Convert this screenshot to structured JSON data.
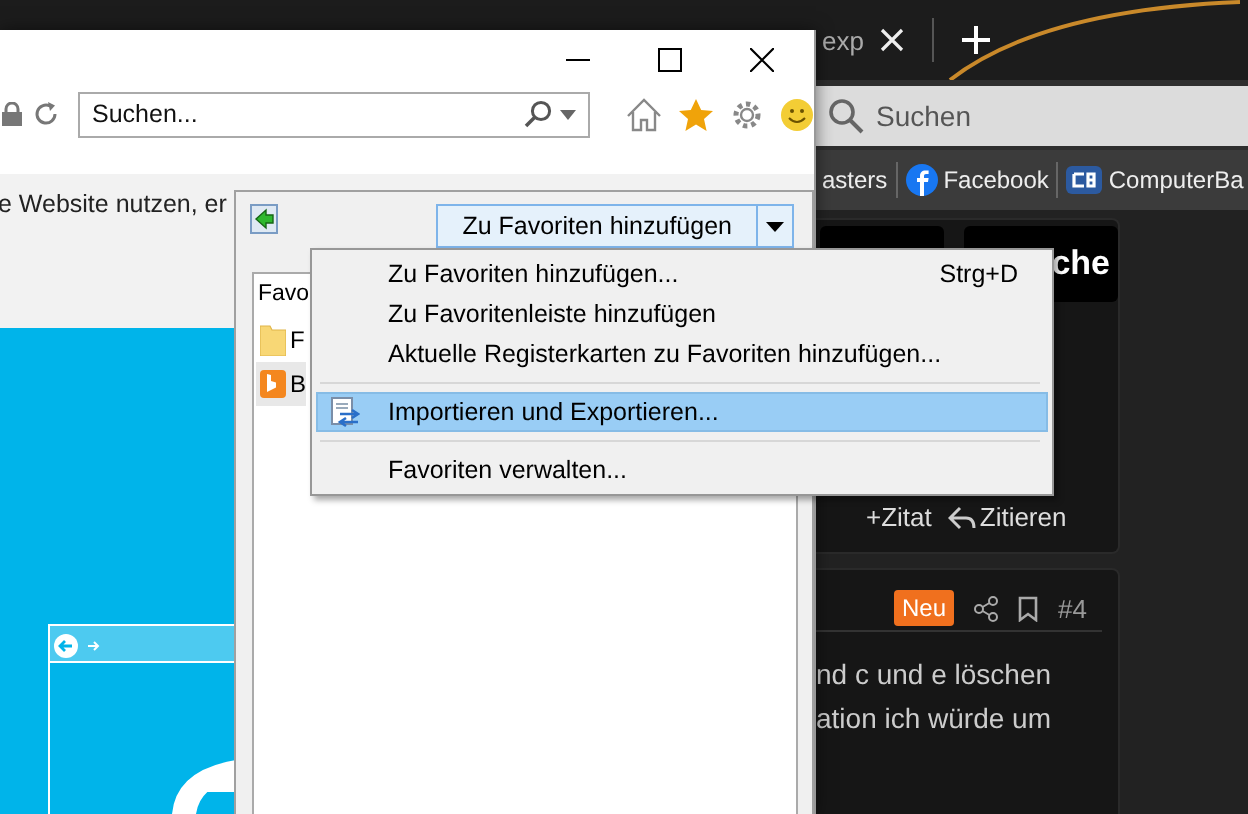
{
  "background_browser": {
    "tab": {
      "title": "exp"
    },
    "search": {
      "placeholder": "Suchen"
    },
    "bookmarks": [
      {
        "label": "asters"
      },
      {
        "label": "Facebook"
      },
      {
        "label": "ComputerBa"
      }
    ],
    "search_button": "che",
    "post_actions": [
      {
        "label": "+Zitat"
      },
      {
        "label": "Zitieren"
      }
    ],
    "post": {
      "badge": "Neu",
      "number": "#4",
      "lines": [
        "nd c und e löschen",
        "ation ich würde um"
      ]
    }
  },
  "ie": {
    "search": {
      "placeholder": "Suchen..."
    },
    "notification": "e Website nutzen, er",
    "favorites": {
      "add_button": "Zu Favoriten hinzufügen",
      "tab": "Favo",
      "items": [
        {
          "label": "F",
          "selected": false
        },
        {
          "label": "B",
          "selected": true
        }
      ],
      "menu": [
        {
          "kind": "item",
          "label": "Zu Favoriten hinzufügen...",
          "shortcut": "Strg+D",
          "selected": false
        },
        {
          "kind": "item",
          "label": "Zu Favoritenleiste hinzufügen",
          "selected": false
        },
        {
          "kind": "item",
          "label": "Aktuelle Registerkarten zu Favoriten hinzufügen...",
          "selected": false
        },
        {
          "kind": "separator"
        },
        {
          "kind": "item",
          "label": "Importieren und Exportieren...",
          "selected": true
        },
        {
          "kind": "separator"
        },
        {
          "kind": "item",
          "label": "Favoriten verwalten...",
          "selected": false
        }
      ]
    }
  }
}
